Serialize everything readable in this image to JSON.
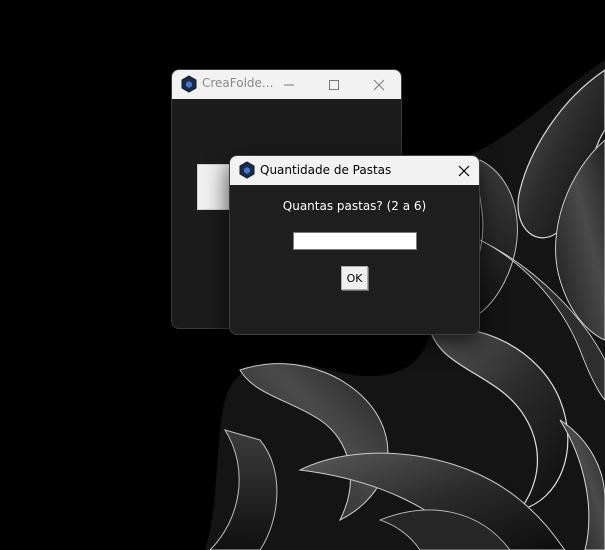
{
  "main_window": {
    "title": "CreaFolde..."
  },
  "dialog": {
    "title": "Quantidade de Pastas",
    "prompt": "Quantas pastas? (2 a 6)",
    "input_value": "",
    "ok_label": "OK"
  },
  "icons": {
    "app": "hexagon-app-icon",
    "minimize": "minimize-icon",
    "maximize": "maximize-icon",
    "close": "close-icon"
  },
  "colors": {
    "desktop_bg": "#000000",
    "window_bg": "#1c1c1c",
    "titlebar_bg": "#f2f2f2",
    "app_icon_hex": "#1b2b4a",
    "app_icon_core": "#4a78c8"
  }
}
